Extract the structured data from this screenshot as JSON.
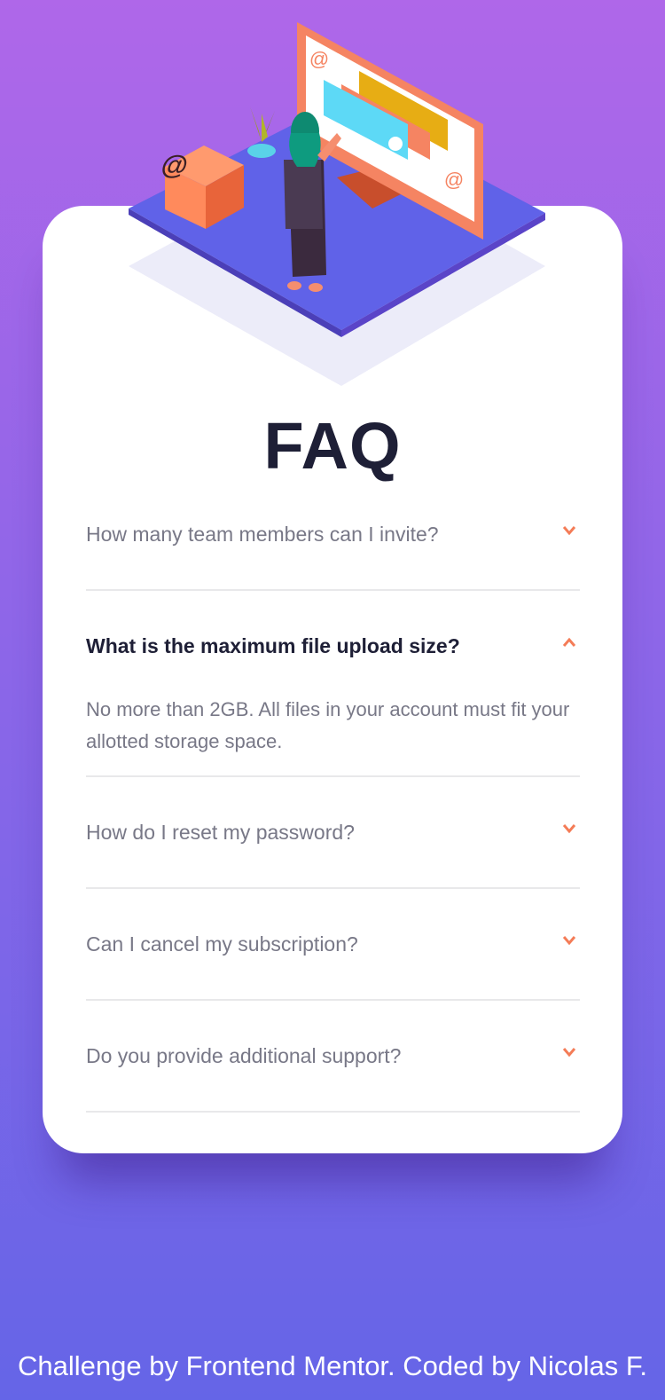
{
  "page": {
    "title": "FAQ"
  },
  "faq": [
    {
      "question": "How many team members can I invite?",
      "open": false,
      "icon": "chevron-down-icon"
    },
    {
      "question": "What is the maximum file upload size?",
      "answer": "No more than 2GB. All files in your account must fit your allotted storage space.",
      "open": true,
      "icon": "chevron-up-icon"
    },
    {
      "question": "How do I reset my password?",
      "open": false,
      "icon": "chevron-down-icon"
    },
    {
      "question": "Can I cancel my subscription?",
      "open": false,
      "icon": "chevron-down-icon"
    },
    {
      "question": "Do you provide additional support?",
      "open": false,
      "icon": "chevron-down-icon"
    }
  ],
  "footer": {
    "credit": "Challenge by Frontend Mentor. Coded by Nicolas F."
  },
  "colors": {
    "background_top": "#af67e9",
    "background_bottom": "#6565e7",
    "card": "#ffffff",
    "title": "#1e1f36",
    "text_muted": "#787887",
    "accent": "#f47c57",
    "divider": "#e8e8ea"
  }
}
